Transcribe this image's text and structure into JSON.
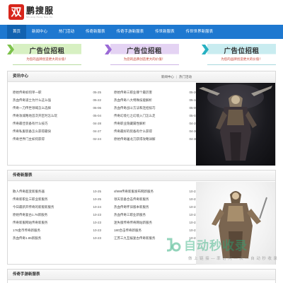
{
  "header": {
    "logo_mark": "双",
    "logo_name": "鹏搜服",
    "logo_sub": "Shuang Peng Sou Fu"
  },
  "nav": {
    "items": [
      "首页",
      "新闻中心",
      "热门活动",
      "传奇新服表",
      "传奇手游新服表",
      "传世新服表",
      "传世世界新服表"
    ],
    "active_index": 0
  },
  "ads": [
    {
      "title": "广告位招租",
      "subtitle": "为您的品牌创造更大的价值！",
      "theme": "green",
      "color": "#7dc24b"
    },
    {
      "title": "广告位招租",
      "subtitle": "为您的品牌创造更大的价值！",
      "theme": "purple",
      "color": "#9b6ad6"
    },
    {
      "title": "广告位招租",
      "subtitle": "为您的品牌创造更大的价值！",
      "theme": "teal",
      "color": "#27b1c2"
    }
  ],
  "news": {
    "title": "资讯中心",
    "links": [
      "新闻中心",
      "热门活动"
    ],
    "left": [
      {
        "title": "原始传奇如何单一职",
        "date": "05-25"
      },
      {
        "title": "热血传奇道士为什么这么强",
        "date": "05-22"
      },
      {
        "title": "传奇一刀传世领域怎么选择",
        "date": "05-06"
      },
      {
        "title": "传奇攻城略地首次开区时怎么玩",
        "date": "05-04"
      },
      {
        "title": "传奇最佳装备有什么技巧",
        "date": "04-28"
      },
      {
        "title": "传奇私服装备怎么获得最快",
        "date": "04-27"
      },
      {
        "title": "传奇世界门主如何获得",
        "date": "02-24"
      }
    ],
    "right": [
      {
        "title": "原始传奇三职业哪个最厉害",
        "date": "05-20"
      },
      {
        "title": "热血传奇八大特殊技能解析",
        "date": "05-16"
      },
      {
        "title": "热血传奇战斗方法和连招技巧",
        "date": "05-05"
      },
      {
        "title": "传奇幻境七之幻境入门怎么走",
        "date": "05-03"
      },
      {
        "title": "传奇职业隐藏属性解析",
        "date": "04-28"
      },
      {
        "title": "传奇最好的装备有什么获得",
        "date": "04-30"
      },
      {
        "title": "原始传奇屠龙刀获得攻略详解",
        "date": "04-30"
      }
    ]
  },
  "servers": {
    "title": "传奇新服表",
    "left": [
      {
        "title": "散人传奇超变新服务器",
        "date": "10-25"
      },
      {
        "title": "传奇新职业三职业新服务",
        "date": "10-25"
      },
      {
        "title": "今日最新开传奇的新版新服务",
        "date": "10-24"
      },
      {
        "title": "原始传奇复古1.76新服务",
        "date": "10-23"
      },
      {
        "title": "传奇新服网站传奇新服务",
        "date": "10-23"
      },
      {
        "title": "176金币传奇新服务",
        "date": "10-23"
      },
      {
        "title": "热血传奇1.85新服务",
        "date": "10-23"
      }
    ],
    "right": [
      {
        "title": "sf999传奇新服发布网新服务",
        "date": "10-23"
      },
      {
        "title": "领天装备合击传奇新服务",
        "date": "10-23"
      },
      {
        "title": "热血传奇怀旧版本新服务",
        "date": "10-23"
      },
      {
        "title": "热血传奇三职业新服务",
        "date": "10-23"
      },
      {
        "title": "迷失版传奇传奇网站新服务",
        "date": "10-23"
      },
      {
        "title": "180合击传奇新服务",
        "date": "10-23"
      },
      {
        "title": "江苏三九互娱复古传奇新服务",
        "date": "10-23"
      }
    ]
  },
  "mobile": {
    "title": "传奇手游新服表"
  },
  "watermark": {
    "main": "自动秒收录",
    "sub": "做 上 链 接 — 率 访 问 — 次 — 自 动 秒 收 录"
  }
}
